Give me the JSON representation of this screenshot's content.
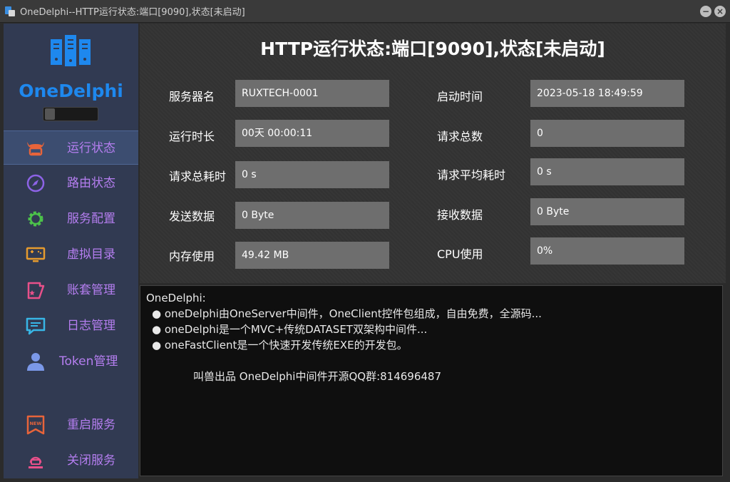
{
  "window": {
    "title": "OneDelphi--HTTP运行状态:端口[9090],状态[未启动]",
    "minimize_glyph": "−",
    "close_glyph": "×"
  },
  "sidebar": {
    "logo_text": "OneDelphi",
    "logo_icon": "server-rack-icon",
    "items": [
      {
        "label": "运行状态",
        "icon": "bull-icon",
        "active": true,
        "color": "#e8643a"
      },
      {
        "label": "路由状态",
        "icon": "compass-icon",
        "active": false,
        "color": "#8d63e6"
      },
      {
        "label": "服务配置",
        "icon": "gear-icon",
        "active": false,
        "color": "#4cc24a"
      },
      {
        "label": "虚拟目录",
        "icon": "monitor-icon",
        "active": false,
        "color": "#e59a2e"
      },
      {
        "label": "账套管理",
        "icon": "ticket-icon",
        "active": false,
        "color": "#e8508a"
      },
      {
        "label": "日志管理",
        "icon": "chat-icon",
        "active": false,
        "color": "#38b6e6"
      },
      {
        "label": "Token管理",
        "icon": "user-icon",
        "active": false,
        "color": "#7b98e8"
      },
      {
        "label": "重启服务",
        "icon": "new-badge-icon",
        "active": false,
        "color": "#e8643a"
      },
      {
        "label": "关闭服务",
        "icon": "power-off-icon",
        "active": false,
        "color": "#e8508a"
      }
    ]
  },
  "main": {
    "title": "HTTP运行状态:端口[9090],状态[未启动]",
    "fields": [
      {
        "label": "服务器名",
        "value": "RUXTECH-0001"
      },
      {
        "label": "启动时间",
        "value": "2023-05-18 18:49:59"
      },
      {
        "label": "运行时长",
        "value": "00天 00:00:11"
      },
      {
        "label": "请求总数",
        "value": "0"
      },
      {
        "label": "请求总耗时",
        "value": "0 s"
      },
      {
        "label": "请求平均耗时",
        "value": "0 s"
      },
      {
        "label": "发送数据",
        "value": "0 Byte"
      },
      {
        "label": "接收数据",
        "value": "0 Byte"
      },
      {
        "label": "内存使用",
        "value": "49.42 MB"
      },
      {
        "label": "CPU使用",
        "value": "0%"
      }
    ]
  },
  "log": {
    "header": "OneDelphi:",
    "bullets": [
      "● oneDelphi由OneServer中间件，OneClient控件包组成，自由免费，全源码...",
      "● oneDelphi是一个MVC+传统DATASET双架构中间件...",
      "● oneFastClient是一个快速开发传统EXE的开发包。"
    ],
    "footer": "叫兽出品  OneDelphi中间件开源QQ群:814696487"
  },
  "colors": {
    "accent": "#1e88ee",
    "menu_text": "#b57ef0",
    "sidebar_bg": "#313a52",
    "field_bg": "#6e6e6e"
  }
}
